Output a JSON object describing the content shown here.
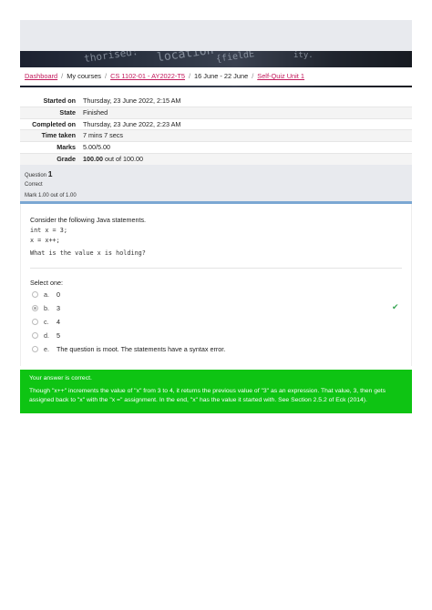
{
  "breadcrumb": {
    "items": [
      "Dashboard",
      "My courses",
      "CS 1102-01 - AY2022-T5",
      "16 June - 22 June",
      "Self-Quiz Unit 1"
    ]
  },
  "banner": {
    "code_fragments": [
      "thorised:",
      "location",
      "{fieldE",
      "ity."
    ]
  },
  "summary": [
    {
      "label": "Started on",
      "value": "Thursday, 23 June 2022, 2:15 AM"
    },
    {
      "label": "State",
      "value": "Finished"
    },
    {
      "label": "Completed on",
      "value": "Thursday, 23 June 2022, 2:23 AM"
    },
    {
      "label": "Time taken",
      "value": "7 mins 7 secs"
    },
    {
      "label": "Marks",
      "value": "5.00/5.00"
    },
    {
      "label": "Grade",
      "value_bold": "100.00",
      "value_rest": " out of 100.00"
    }
  ],
  "question": {
    "label": "Question",
    "number": "1",
    "state": "Correct",
    "mark": "Mark 1.00 out of 1.00",
    "text": "Consider the following Java statements.",
    "code_lines": [
      "int x = 3;",
      "x = x++;"
    ],
    "prompt": "What is the value x is holding?",
    "select_label": "Select one:",
    "options": [
      {
        "letter": "a.",
        "text": "0",
        "checked": false
      },
      {
        "letter": "b.",
        "text": "3",
        "checked": true
      },
      {
        "letter": "c.",
        "text": "4",
        "checked": false
      },
      {
        "letter": "d.",
        "text": "5",
        "checked": false
      },
      {
        "letter": "e.",
        "text": "The question is moot. The statements have a syntax error.",
        "checked": false
      }
    ],
    "correct_icon": "check-icon"
  },
  "feedback": {
    "status": "Your answer is correct.",
    "explanation": "Though \"x++\" increments the value of \"x\" from 3 to 4, it returns the previous value of \"3\" as an expression. That value, 3, then gets assigned back to \"x\" with the \"x =\" assignment. In the end, \"x\" has the value it started with. See Section 2.5.2 of Eck (2014).",
    "color": "#0ec413"
  }
}
